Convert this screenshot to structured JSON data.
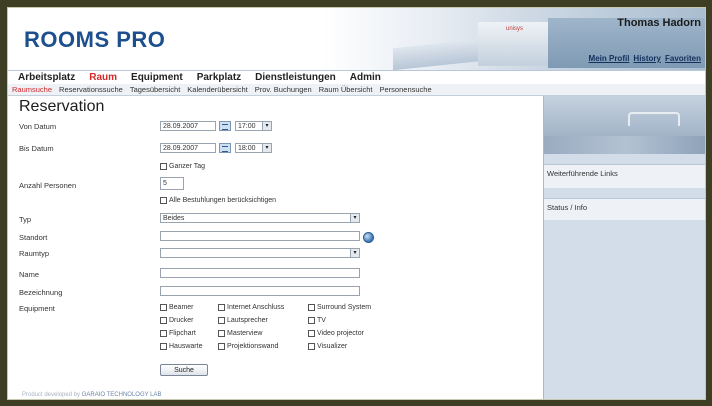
{
  "app": {
    "logo": "ROOMS PRO",
    "brandmark": "unisys",
    "user_name": "Thomas Hadorn",
    "user_links": [
      "Mein Profil",
      "History",
      "Favoriten"
    ]
  },
  "nav": {
    "items": [
      "Arbeitsplatz",
      "Raum",
      "Equipment",
      "Parkplatz",
      "Dienstleistungen",
      "Admin"
    ],
    "active": "Raum"
  },
  "subnav": {
    "items": [
      "Raumsuche",
      "Reservationssuche",
      "Tagesübersicht",
      "Kalenderübersicht",
      "Prov. Buchungen",
      "Raum Übersicht",
      "Personensuche"
    ],
    "active": "Raumsuche"
  },
  "form": {
    "title": "Reservation",
    "von_datum": {
      "label": "Von Datum",
      "date": "28.09.2007",
      "time": "17:00"
    },
    "bis_datum": {
      "label": "Bis Datum",
      "date": "28.09.2007",
      "time": "18:00"
    },
    "ganzer_tag": "Ganzer Tag",
    "anzahl_personen": {
      "label": "Anzahl Personen",
      "value": "5"
    },
    "alle_bestuhlungen": "Alle Bestuhlungen berücksichtigen",
    "typ": {
      "label": "Typ",
      "value": "Beides"
    },
    "standort": {
      "label": "Standort",
      "value": ""
    },
    "raumtyp": {
      "label": "Raumtyp",
      "value": ""
    },
    "name": {
      "label": "Name",
      "value": ""
    },
    "bezeichnung": {
      "label": "Bezeichnung",
      "value": ""
    },
    "equipment": {
      "label": "Equipment",
      "col1": [
        "Beamer",
        "Drucker",
        "Flipchart",
        "Hauswarte"
      ],
      "col2": [
        "Internet Anschluss",
        "Lautsprecher",
        "Masterview",
        "Projektionswand"
      ],
      "col3": [
        "Surround System",
        "TV",
        "Video projector",
        "Visualizer"
      ]
    },
    "search_button": "Suche"
  },
  "sidebar": {
    "links_title": "Weiterführende Links",
    "status_title": "Status / Info"
  },
  "footer": {
    "prefix": "Product developed by",
    "company": "GARAIO TECHNOLOGY LAB"
  }
}
